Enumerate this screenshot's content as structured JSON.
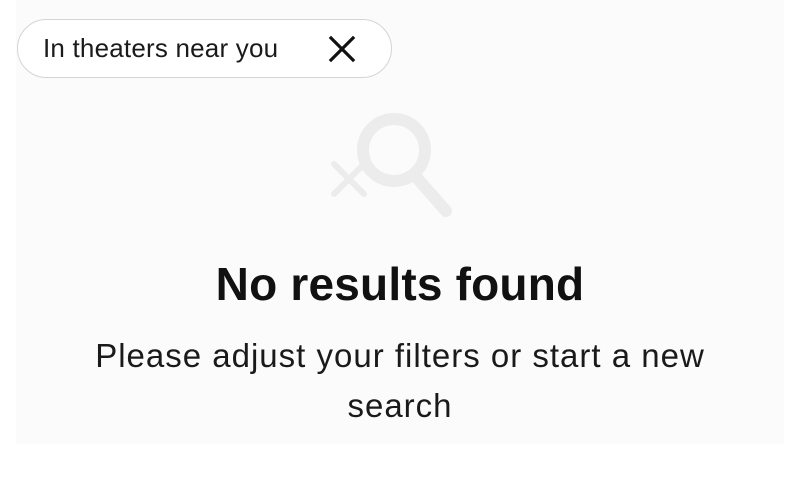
{
  "filter_chip": {
    "label": "In theaters near you",
    "remove_icon": "close-icon"
  },
  "empty_state": {
    "illustration_icon": "search-no-results-icon",
    "title": "No results found",
    "message": "Please adjust your filters or start a new search"
  },
  "colors": {
    "panel_background": "#fbfbfb",
    "chip_border": "#d4d4d4",
    "illustration": "#ececec",
    "text": "#111111"
  }
}
